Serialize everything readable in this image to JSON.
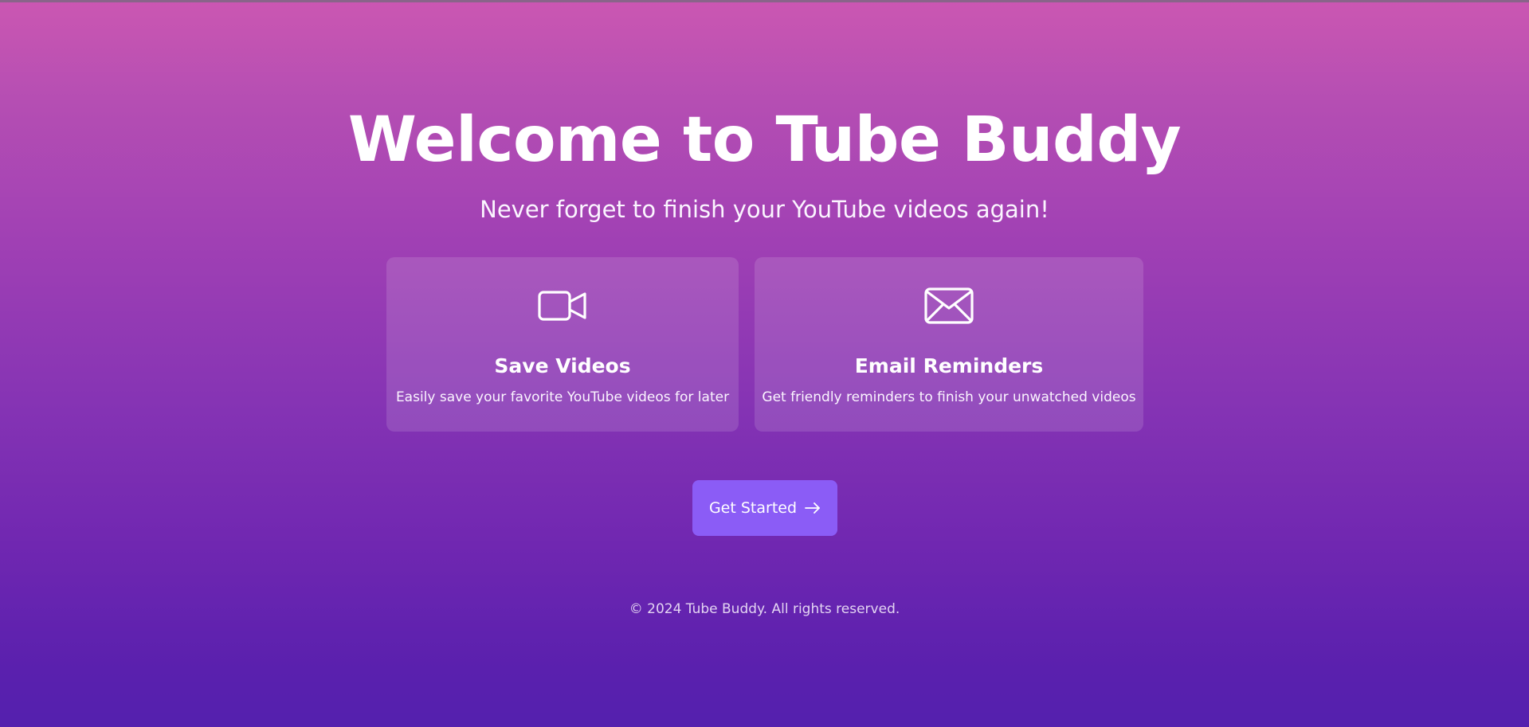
{
  "hero": {
    "title": "Welcome to Tube Buddy",
    "subtitle": "Never forget to finish your YouTube videos again!"
  },
  "features": [
    {
      "icon": "video-camera-icon",
      "title": "Save Videos",
      "description": "Easily save your favorite YouTube videos for later"
    },
    {
      "icon": "envelope-icon",
      "title": "Email Reminders",
      "description": "Get friendly reminders to finish your unwatched videos"
    }
  ],
  "cta": {
    "label": "Get Started",
    "icon": "arrow-right-icon"
  },
  "footer": {
    "copyright": "© 2024 Tube Buddy. All rights reserved."
  },
  "colors": {
    "gradient_top": "#cb57b2",
    "gradient_bottom": "#5420ae",
    "button": "#8b5cf6",
    "text": "#ffffff"
  }
}
